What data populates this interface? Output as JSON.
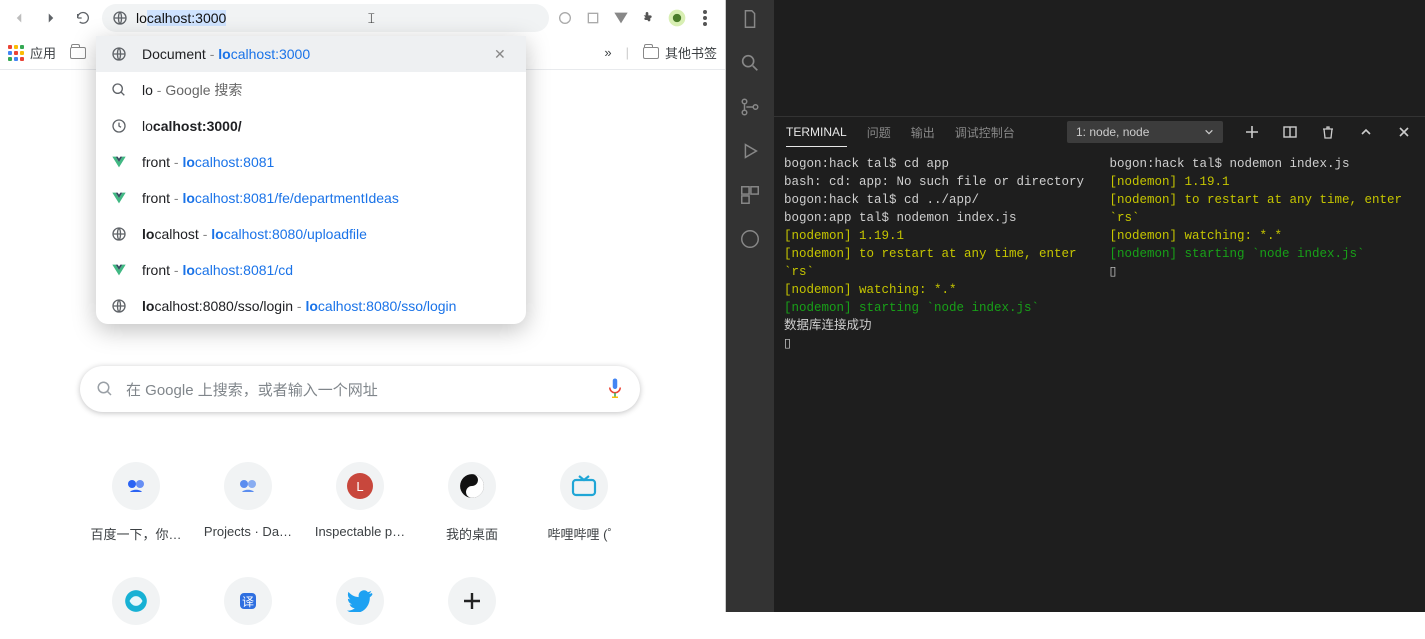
{
  "chrome": {
    "address_typed": "lo",
    "address_completed": "calhost:3000",
    "bookmarks": {
      "apps_label": "应用",
      "overflow": "»",
      "other_label": "其他书签"
    },
    "suggestions": [
      {
        "icon": "globe",
        "title": "Document",
        "url_prefix": "lo",
        "url_rest": "calhost:3000",
        "selected": true,
        "closeable": true
      },
      {
        "icon": "search",
        "title": "lo",
        "secondary": "Google 搜索"
      },
      {
        "icon": "history",
        "text_prefix": "lo",
        "text_bold": "calhost:3000/"
      },
      {
        "icon": "vue",
        "title": "front",
        "url_prefix": "lo",
        "url_rest": "calhost:8081"
      },
      {
        "icon": "vue",
        "title": "front",
        "url_prefix": "lo",
        "url_rest": "calhost:8081/fe/departmentIdeas"
      },
      {
        "icon": "globe",
        "title_prefix": "lo",
        "title_rest": "calhost",
        "url_prefix": "lo",
        "url_rest": "calhost:8080/uploadfile"
      },
      {
        "icon": "vue",
        "title": "front",
        "url_prefix": "lo",
        "url_rest": "calhost:8081/cd"
      },
      {
        "icon": "globe",
        "title_prefix": "lo",
        "title_rest": "calhost:8080/sso/login",
        "url_prefix": "lo",
        "url_rest": "calhost:8080/sso/login"
      }
    ],
    "search_placeholder": "在 Google 上搜索，或者输入一个网址",
    "shortcuts": [
      {
        "label": "百度一下，你…",
        "color": "#2b63f3"
      },
      {
        "label": "Projects · Da…",
        "color": "#5b8def"
      },
      {
        "label": "Inspectable p…",
        "color": "#c8473c",
        "letter": "L"
      },
      {
        "label": "我的桌面",
        "yinyang": true
      },
      {
        "label": "哔哩哔哩 (゜",
        "color": "#20a6d6",
        "tv": true
      }
    ],
    "shortcuts_row2": [
      {
        "color": "#17b1d4",
        "swirl": true
      },
      {
        "color": "#2f6fe0",
        "square": true
      },
      {
        "color": "#1da1f2",
        "twitter": true
      },
      {
        "plus": true
      }
    ]
  },
  "vscode": {
    "panel_tabs": {
      "terminal": "TERMINAL",
      "problems": "问题",
      "output": "输出",
      "debug": "调试控制台"
    },
    "term_selector": "1: node, node",
    "term_left": [
      {
        "t": "bogon:hack tal$ cd app"
      },
      {
        "t": "bash: cd: app: No such file or directory"
      },
      {
        "t": "bogon:hack tal$ cd ../app/"
      },
      {
        "t": "bogon:app tal$ nodemon index.js"
      },
      {
        "t": "[nodemon] 1.19.1",
        "c": "y"
      },
      {
        "t": "[nodemon] to restart at any time, enter `rs`",
        "c": "y"
      },
      {
        "t": "[nodemon] watching: *.*",
        "c": "y"
      },
      {
        "t": "[nodemon] starting `node index.js`",
        "c": "g"
      },
      {
        "t": "数据库连接成功"
      },
      {
        "t": "▯"
      }
    ],
    "term_right": [
      {
        "t": "bogon:hack tal$ nodemon index.js"
      },
      {
        "t": "[nodemon] 1.19.1",
        "c": "y"
      },
      {
        "t": "[nodemon] to restart at any time, enter `rs`",
        "c": "y"
      },
      {
        "t": "[nodemon] watching: *.*",
        "c": "y"
      },
      {
        "t": "[nodemon] starting `node index.js`",
        "c": "g"
      },
      {
        "t": "▯"
      }
    ]
  }
}
